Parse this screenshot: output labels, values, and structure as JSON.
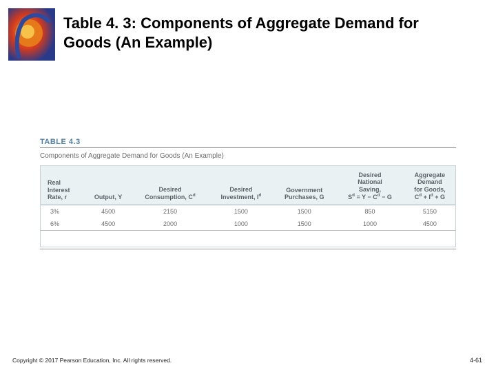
{
  "slide": {
    "title": "Table 4. 3: Components of Aggregate Demand for Goods (An Example)"
  },
  "table": {
    "label": "TABLE 4.3",
    "caption": "Components of Aggregate Demand for Goods (An Example)",
    "headers": {
      "c1": "Real\nInterest\nRate, r",
      "c2": "Output, Y",
      "c3": "Desired\nConsumption, Cᵈ",
      "c4": "Desired\nInvestment, Iᵈ",
      "c5": "Government\nPurchases, G",
      "c6": "Desired\nNational\nSaving,\nSᵈ = Y − Cᵈ − G",
      "c7": "Aggregate\nDemand\nfor Goods,\nCᵈ + Iᵈ + G"
    },
    "rows": [
      {
        "r": "3%",
        "y": "4500",
        "cd": "2150",
        "id": "1500",
        "g": "1500",
        "sd": "850",
        "ad": "5150"
      },
      {
        "r": "6%",
        "y": "4500",
        "cd": "2000",
        "id": "1000",
        "g": "1500",
        "sd": "1000",
        "ad": "4500"
      }
    ]
  },
  "footer": {
    "copyright": "Copyright © 2017 Pearson Education, Inc. All rights reserved.",
    "page": "4-61"
  }
}
